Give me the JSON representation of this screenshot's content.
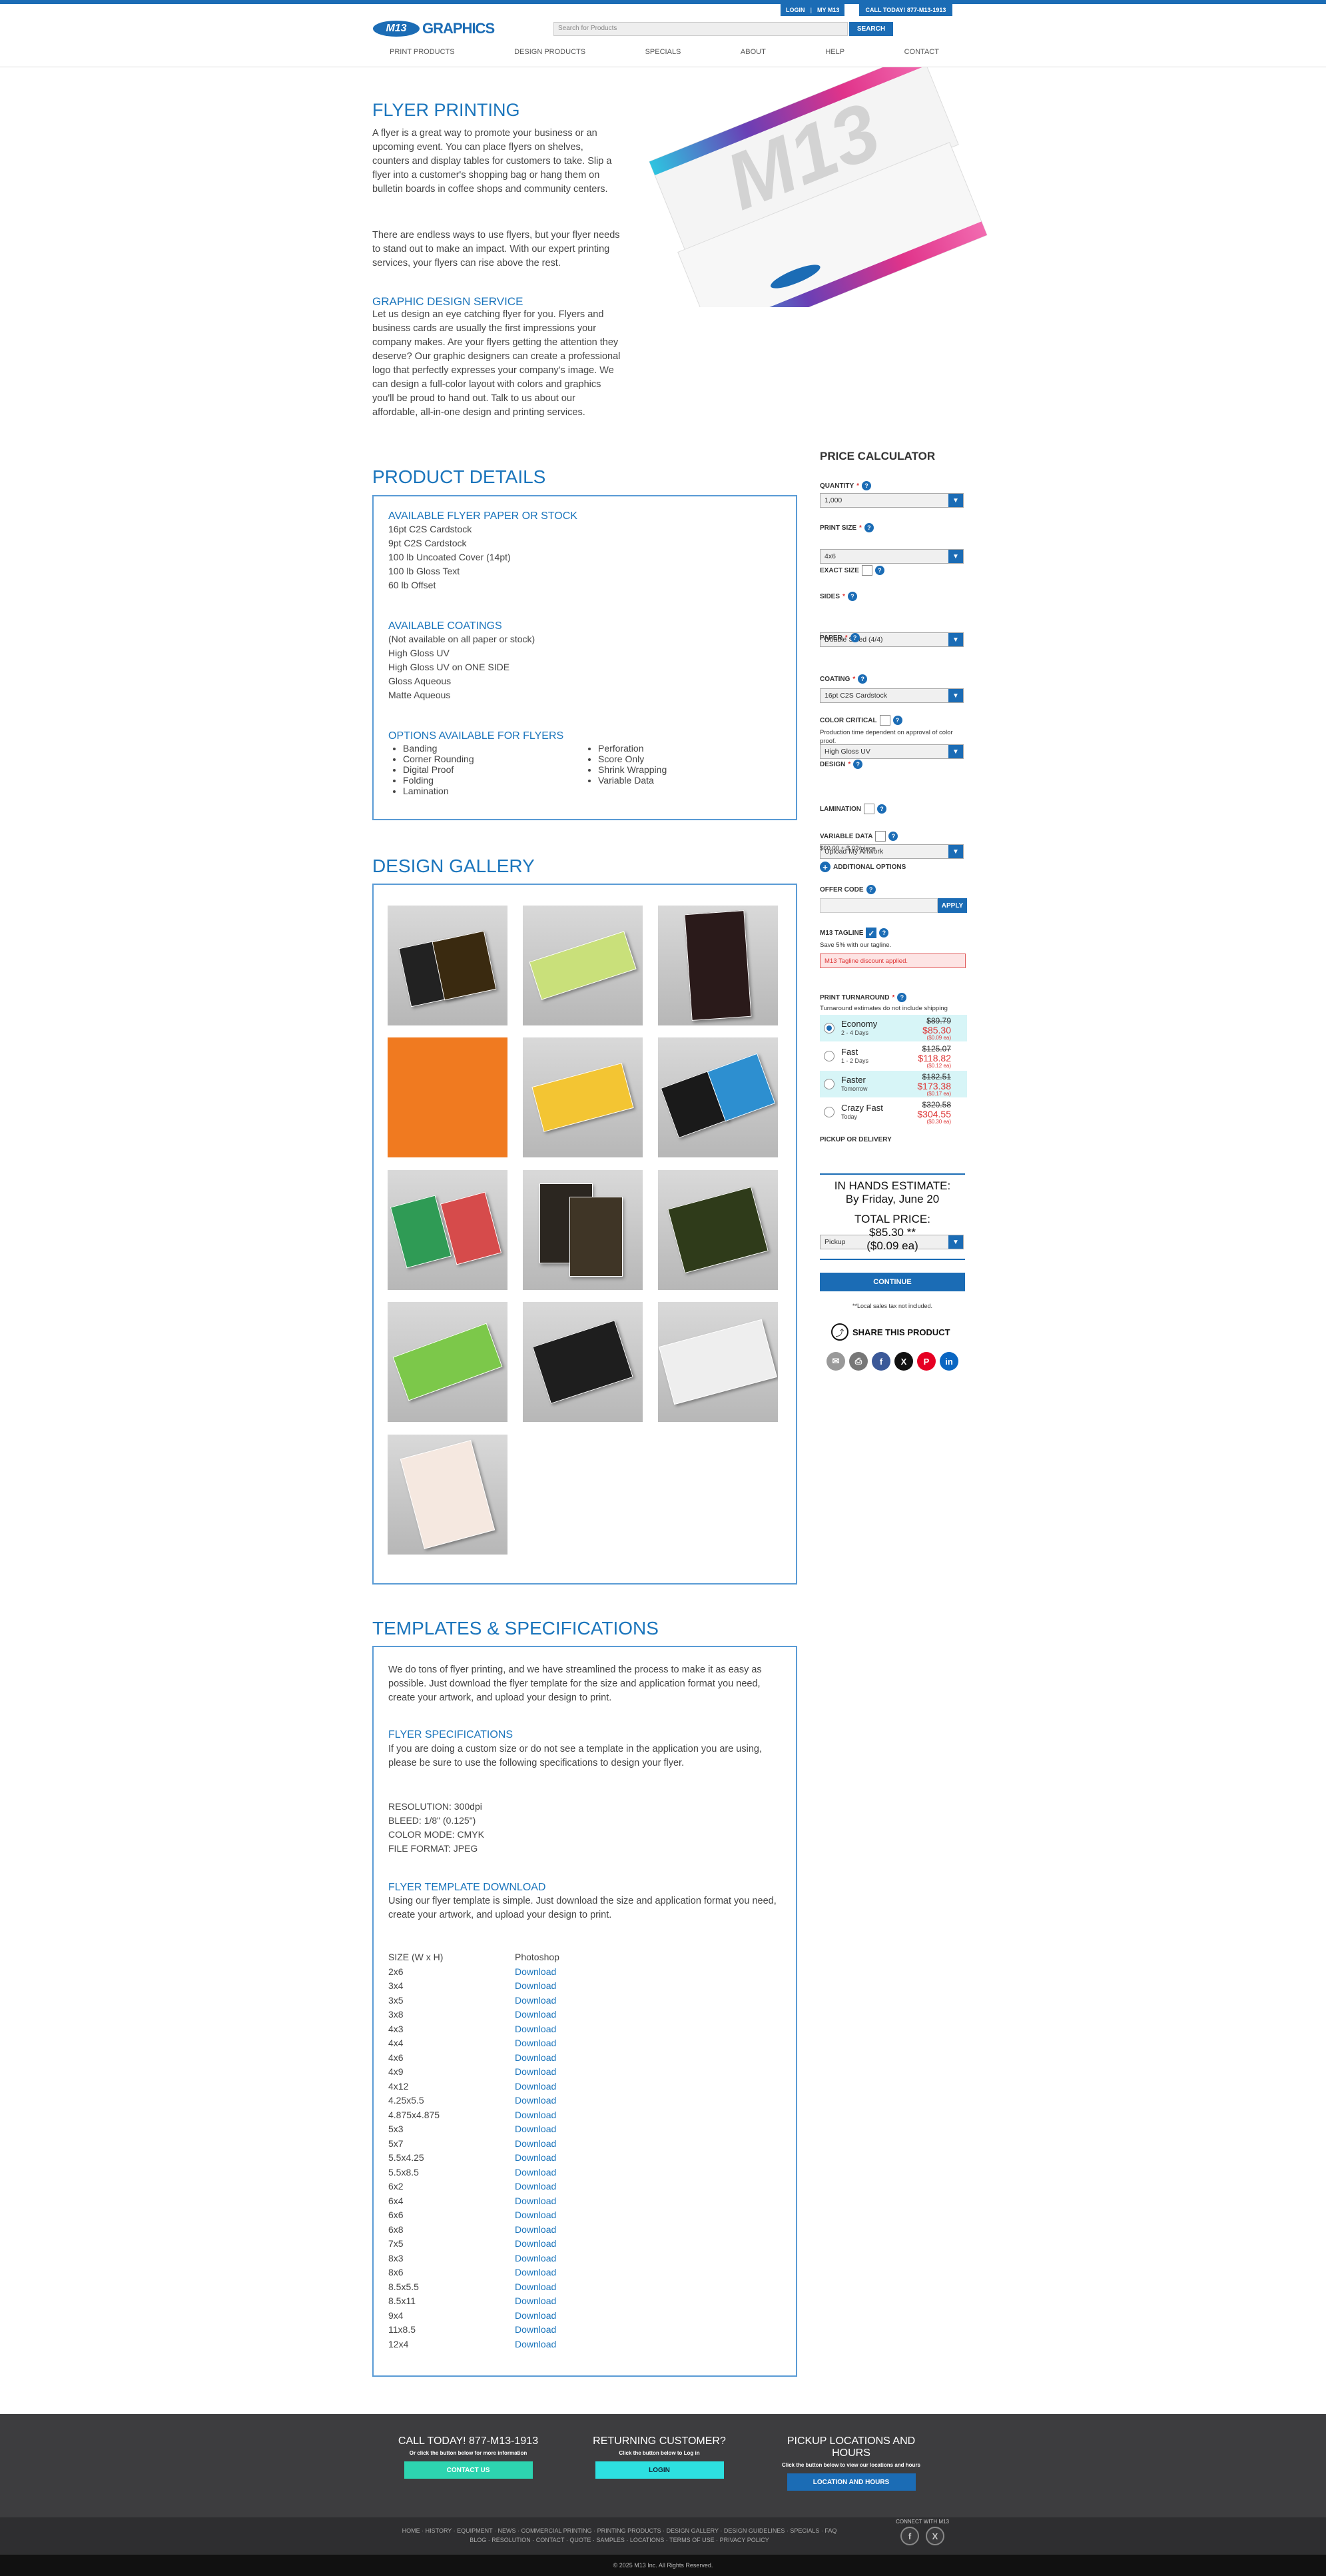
{
  "header": {
    "login": "LOGIN",
    "my_account": "MY M13",
    "call": "CALL TODAY! 877-M13-1913",
    "logo_mark": "M13",
    "logo_word": "GRAPHICS",
    "search_placeholder": "Search for Products",
    "search_button": "SEARCH",
    "nav": [
      "PRINT PRODUCTS",
      "DESIGN PRODUCTS",
      "SPECIALS",
      "ABOUT",
      "HELP",
      "CONTACT"
    ]
  },
  "hero": {
    "title": "FLYER PRINTING",
    "p1": "A flyer is a great way to promote your business or an upcoming event. You can place flyers on shelves, counters and display tables for customers to take. Slip a flyer into a customer's shopping bag or hang them on bulletin boards in coffee shops and community centers.",
    "p2": "There are endless ways to use flyers, but your flyer needs to stand out to make an impact. With our expert printing services, your flyers can rise above the rest.",
    "gds_title": "GRAPHIC DESIGN SERVICE",
    "gds_p": "Let us design an eye catching flyer for you. Flyers and business cards are usually the first impressions your company makes. Are your flyers getting the attention they deserve? Our graphic designers can create a professional logo that perfectly expresses your company's image. We can design a full-color layout with colors and graphics you'll be proud to hand out. Talk to us about our affordable, all-in-one design and printing services.",
    "image_text": "M13"
  },
  "details": {
    "title": "PRODUCT DETAILS",
    "paper_title": "AVAILABLE FLYER PAPER OR STOCK",
    "papers": [
      "16pt C2S Cardstock",
      "9pt C2S Cardstock",
      "100 lb Uncoated Cover (14pt)",
      "100 lb Gloss Text",
      "60 lb Offset"
    ],
    "coat_title": "AVAILABLE COATINGS",
    "coatings": [
      "(Not available on all paper or stock)",
      "High Gloss UV",
      "High Gloss UV on ONE SIDE",
      "Gloss Aqueous",
      "Matte Aqueous"
    ],
    "opt_title": "OPTIONS AVAILABLE FOR FLYERS",
    "options_left": [
      "Banding",
      "Corner Rounding",
      "Digital Proof",
      "Folding",
      "Lamination"
    ],
    "options_right": [
      "Perforation",
      "Score Only",
      "Shrink Wrapping",
      "Variable Data"
    ]
  },
  "gallery": {
    "title": "DESIGN GALLERY"
  },
  "templates": {
    "title": "TEMPLATES & SPECIFICATIONS",
    "intro": "We do tons of flyer printing, and we have streamlined the process to make it as easy as possible. Just download the flyer template for the size and application format you need, create your artwork, and upload your design to print.",
    "spec_title": "FLYER SPECIFICATIONS",
    "spec_p": "If you are doing a custom size or do not see a template in the application you are using, please be sure to use the following specifications to design your flyer.",
    "specs": [
      "RESOLUTION: 300dpi",
      "BLEED: 1/8\" (0.125\")",
      "COLOR MODE: CMYK",
      "FILE FORMAT: JPEG"
    ],
    "dl_title": "FLYER TEMPLATE DOWNLOAD",
    "dl_p": "Using our flyer template is simple. Just download the size and application format you need, create your artwork, and upload your design to print.",
    "col_size": "SIZE (W x H)",
    "col_app": "Photoshop",
    "download": "Download",
    "sizes": [
      "2x6",
      "3x4",
      "3x5",
      "3x8",
      "4x3",
      "4x4",
      "4x6",
      "4x9",
      "4x12",
      "4.25x5.5",
      "4.875x4.875",
      "5x3",
      "5x7",
      "5.5x4.25",
      "5.5x8.5",
      "6x2",
      "6x4",
      "6x6",
      "6x8",
      "7x5",
      "8x3",
      "8x6",
      "8.5x5.5",
      "8.5x11",
      "9x4",
      "11x8.5",
      "12x4"
    ]
  },
  "calc": {
    "title": "PRICE CALCULATOR",
    "quantity_label": "QUANTITY",
    "quantity": "1,000",
    "size_label": "PRINT SIZE",
    "size": "4x6",
    "exact_label": "EXACT SIZE",
    "sides_label": "SIDES",
    "sides": "Double Sided (4/4)",
    "paper_label": "PAPER",
    "paper": "16pt C2S Cardstock",
    "coating_label": "COATING",
    "coating": "High Gloss UV",
    "color_label": "COLOR CRITICAL",
    "color_note": "Production time dependent on approval of color proof.",
    "design_label": "DESIGN",
    "design": "Upload My Artwork",
    "lamination_label": "LAMINATION",
    "variable_label": "VARIABLE DATA",
    "variable_note": "$60.00 + $.02/piece",
    "additional": "ADDITIONAL OPTIONS",
    "offer_label": "OFFER CODE",
    "apply": "APPLY",
    "tagline_label": "M13 TAGLINE",
    "tagline_note": "Save 5% with our tagline.",
    "tagline_applied": "M13 Tagline discount applied.",
    "turn_label": "PRINT TURNAROUND",
    "turn_note": "Turnaround estimates do not include shipping",
    "turnaround": [
      {
        "name": "Economy",
        "sub": "2 - 4 Days",
        "old": "$89.79",
        "new": "$85.30",
        "ea": "($0.09 ea)",
        "selected": true
      },
      {
        "name": "Fast",
        "sub": "1 - 2 Days",
        "old": "$125.07",
        "new": "$118.82",
        "ea": "($0.12 ea)",
        "selected": false
      },
      {
        "name": "Faster",
        "sub": "Tomorrow",
        "old": "$182.51",
        "new": "$173.38",
        "ea": "($0.17 ea)",
        "selected": false
      },
      {
        "name": "Crazy Fast",
        "sub": "Today",
        "old": "$320.58",
        "new": "$304.55",
        "ea": "($0.30 ea)",
        "selected": false
      }
    ],
    "pickup_label": "PICKUP OR DELIVERY",
    "pickup": "Pickup",
    "estimate_title": "IN HANDS ESTIMATE:",
    "estimate_date": "By Friday, June 20",
    "total_title": "TOTAL PRICE:",
    "total": "$85.30 **",
    "total_ea": "($0.09 ea)",
    "continue": "CONTINUE",
    "tax_note": "**Local sales tax not included.",
    "share": "SHARE THIS PRODUCT"
  },
  "footer": {
    "call_h": "CALL TODAY! 877-M13-1913",
    "call_s": "Or click the button below for more information",
    "call_b": "CONTACT US",
    "ret_h": "RETURNING CUSTOMER?",
    "ret_s": "Click the button below to Log in",
    "ret_b": "LOGIN",
    "loc_h": "PICKUP LOCATIONS AND HOURS",
    "loc_s": "Click the button below to view our locations and hours",
    "loc_b": "LOCATION AND HOURS",
    "links1": "HOME  ·  HISTORY  ·  EQUIPMENT  ·  NEWS  ·  COMMERCIAL PRINTING  ·  PRINTING PRODUCTS  ·  DESIGN GALLERY  ·  DESIGN GUIDELINES  ·  SPECIALS  ·  FAQ",
    "links2": "BLOG  ·  RESOLUTION  ·  CONTACT  ·  QUOTE  ·  SAMPLES  ·  LOCATIONS  ·  TERMS OF USE  ·  PRIVACY POLICY",
    "connect": "CONNECT WITH M13",
    "copyright": "© 2025 M13 Inc. All Rights Reserved."
  },
  "colors": {
    "brand": "#1b6cb5",
    "link": "#1b75bc",
    "accent_cyan": "#2de0e0",
    "price_red": "#dd3333"
  }
}
